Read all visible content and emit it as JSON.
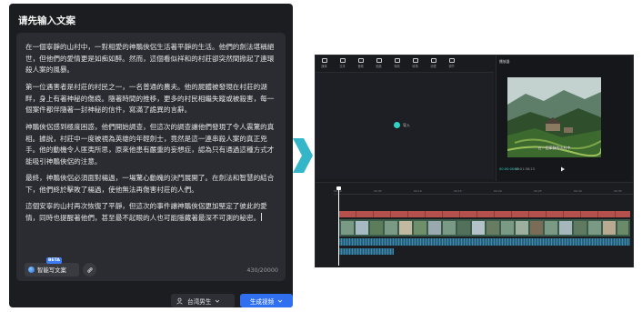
{
  "left_panel": {
    "title": "请先输入文案",
    "paragraphs": [
      "在一個寧靜的山村中，一對相愛的神鵰俠侶生活著平靜的生活。他們的劍法堪稱絕世，但他們的愛情更是如痴如醉。然而，這個看似祥和的村莊卻突然間掀起了連環殺人案的風暴。",
      "第一位遇害者是村莊的村民之一，一名普通的農夫。他的屍體被發現在村莊的湖畔，身上有著神秘的傷痕。隨著時間的推移，更多的村民相繼失蹤或被殺害，每一個案件都伴隨著一封神秘的信件，寫滿了詭異的言辭。",
      "神鵰俠侶感到極度困惑，他們開始調查，但這次的調查讓他們發現了令人震驚的真相。據說，村莊中一度被視為英雄的年輕劍士，竟然是這一連串殺人案的真正兇手。他的動機令人匪夷所思，原來他患有嚴重的妄想症，認為只有通過這種方式才能吸引神鵰俠侶的注意。",
      "最終，神鵰俠侶必須面對楊過，一場驚心動魄的決鬥展開了。在劍法和智慧的結合下，他們終於擊敗了楊過，使他無法再傷害村莊的人們。",
      "這個安寧的山村再次恢復了平靜，但這次的事件讓神鵰俠侶更加堅定了彼此的愛情，同時也提醒著他們，甚至最不起眼的人也可能隱藏著最深不可測的秘密。"
    ],
    "ai_button_label": "智能写文案",
    "beta_badge": "BETA",
    "char_counter": "430/20000",
    "voice_selector": "台湾男生",
    "generate_button": "生成视频"
  },
  "editor": {
    "toolbar": [
      "媒体",
      "文本",
      "音频",
      "贴纸",
      "特效",
      "转场",
      "滤镜",
      "调节"
    ],
    "import_label": "导入",
    "player_title": "播放器",
    "subtitle": "在一個寧靜的山村中",
    "time_current": "00:00:00:00",
    "time_total": "00:01:58:23",
    "ruler_ticks": [
      "00:00",
      "00:05",
      "00:10",
      "00:15",
      "00:20",
      "00:25",
      "00:30",
      "00:35"
    ]
  },
  "colors": {
    "accent": "#2f6ff0",
    "teal": "#2fd3c5",
    "panel_bg": "#1c1d21"
  }
}
